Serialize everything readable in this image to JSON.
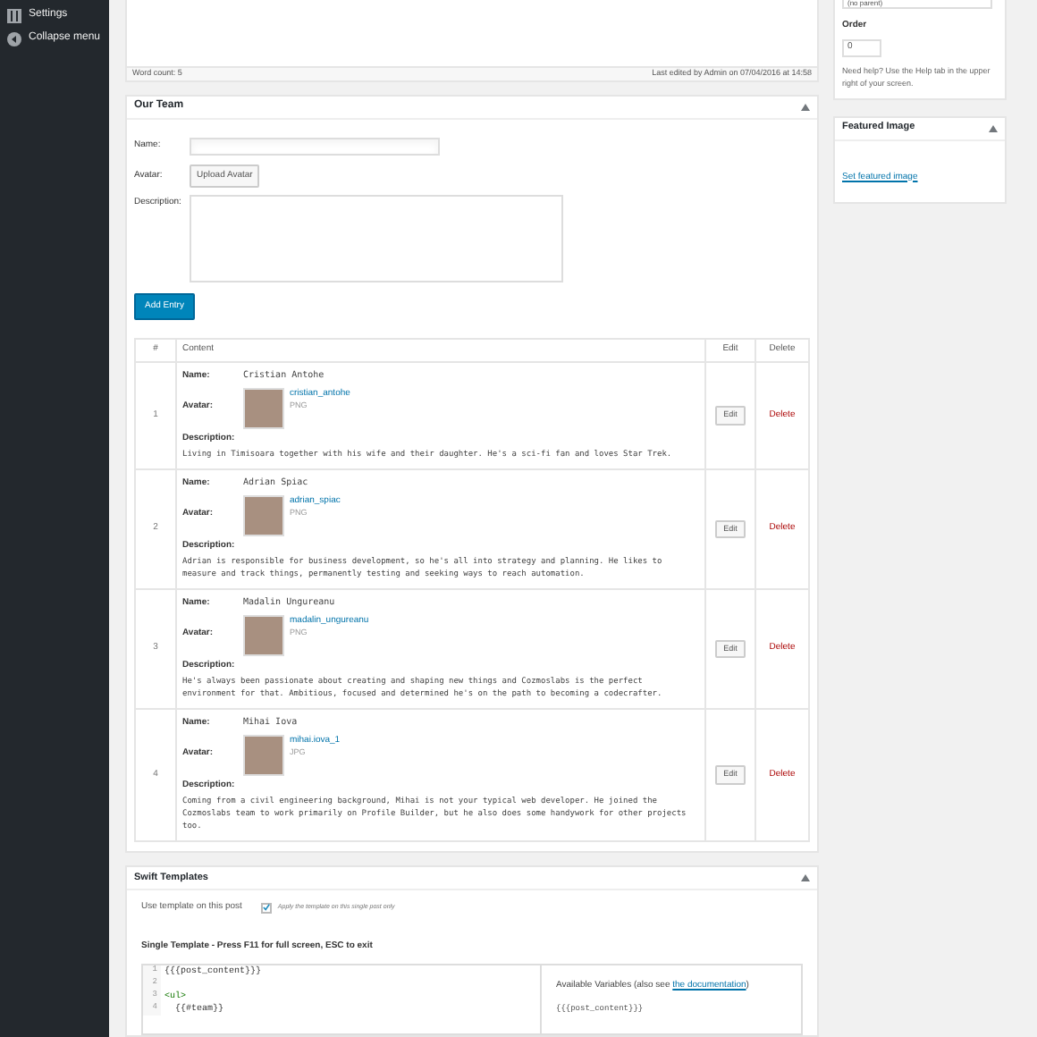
{
  "admin_menu": {
    "items": [
      {
        "label": "Settings",
        "kind": "settings"
      },
      {
        "label": "Collapse menu",
        "kind": "collapse"
      }
    ]
  },
  "editor": {
    "word_count": "Word count: 5",
    "last_edited": "Last edited by Admin on 07/04/2016 at 14:58"
  },
  "our_team": {
    "title": "Our Team",
    "form": {
      "name_label": "Name:",
      "avatar_label": "Avatar:",
      "upload_button": "Upload Avatar",
      "description_label": "Description:"
    },
    "add_button": "Add Entry",
    "table": {
      "columns": [
        "#",
        "Content",
        "Edit",
        "Delete"
      ],
      "rows": [
        {
          "number": "1",
          "name_label": "Name:",
          "name": "Cristian Antohe",
          "avatar_label": "Avatar:",
          "file": "cristian_antohe",
          "type": "PNG",
          "description_label": "Description:",
          "description": "Living in Timisoara together with his wife and their daughter. He's a sci-fi fan and loves Star Trek.",
          "edit": "Edit",
          "delete": "Delete"
        },
        {
          "number": "2",
          "name_label": "Name:",
          "name": "Adrian Spiac",
          "avatar_label": "Avatar:",
          "file": "adrian_spiac",
          "type": "PNG",
          "description_label": "Description:",
          "description": "Adrian is responsible for business development, so he's all into strategy and planning. He likes to measure and track things, permanently testing and seeking ways to reach automation.",
          "edit": "Edit",
          "delete": "Delete"
        },
        {
          "number": "3",
          "name_label": "Name:",
          "name": "Madalin Ungureanu",
          "avatar_label": "Avatar:",
          "file": "madalin_ungureanu",
          "type": "PNG",
          "description_label": "Description:",
          "description": "He's always been passionate about creating and shaping new things and Cozmoslabs is the perfect environment for that. Ambitious, focused and determined he's on the path to becoming a codecrafter.",
          "edit": "Edit",
          "delete": "Delete"
        },
        {
          "number": "4",
          "name_label": "Name:",
          "name": "Mihai Iova",
          "avatar_label": "Avatar:",
          "file": "mihai.iova_1",
          "type": "JPG",
          "description_label": "Description:",
          "description": "Coming from a civil engineering background, Mihai is not your typical web developer. He joined the Cozmoslabs team to work primarily on Profile Builder, but he also does some handywork for other projects too.",
          "edit": "Edit",
          "delete": "Delete"
        }
      ]
    }
  },
  "swift_templates": {
    "title": "Swift Templates",
    "use_label": "Use template on this post",
    "apply_checkbox": {
      "label": "Apply the template on this single post only",
      "checked": true
    },
    "section_title": "Single Template - Press F11 for full screen, ESC to exit",
    "code_lines": [
      {
        "number": "1",
        "text": "{{{post_content}}}",
        "kind": "plain"
      },
      {
        "number": "2"
      },
      {
        "number": "3",
        "text": "<ul>",
        "kind": "tag"
      },
      {
        "number": "4",
        "text": "  {{#team}}",
        "kind": "plain"
      }
    ],
    "variables_title": "Available Variables (also see ",
    "variables_link": "the documentation",
    "variables_close": ")",
    "variables": [
      "{{{post_content}}}"
    ]
  },
  "page_attributes": {
    "parent_value": "(no parent)",
    "order_label": "Order",
    "order_value": "0",
    "help": "Need help? Use the Help tab in the upper right of your screen."
  },
  "featured_image": {
    "title": "Featured Image",
    "link": "Set featured image"
  }
}
